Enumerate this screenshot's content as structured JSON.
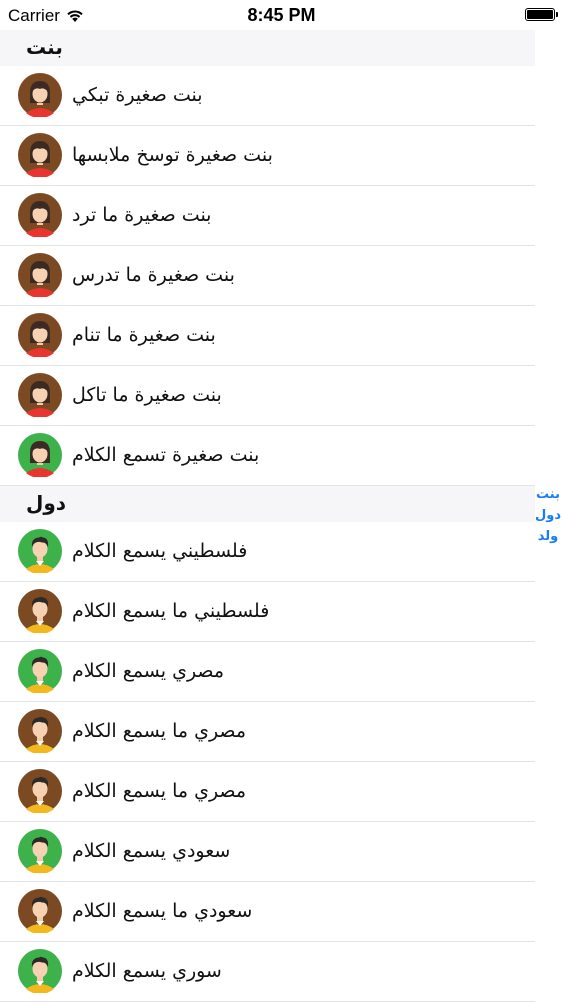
{
  "status_bar": {
    "carrier": "Carrier",
    "time": "8:45 PM",
    "battery_level": 1.0
  },
  "colors": {
    "accent": "#1a7cf5",
    "header_bg": "#f6f6f8",
    "avatar_brown": "#7b4a23",
    "avatar_green": "#3db14a",
    "girl_shirt": "#e8352f",
    "boy_shirt": "#f2b81e"
  },
  "sections": [
    {
      "title": "بنت",
      "items": [
        {
          "label": "بنت صغيرة تبكي",
          "avatar": "girl-avatar",
          "bg": "brown"
        },
        {
          "label": "بنت صغيرة توسخ ملابسها",
          "avatar": "girl-avatar",
          "bg": "brown"
        },
        {
          "label": "بنت صغيرة ما ترد",
          "avatar": "girl-avatar",
          "bg": "brown"
        },
        {
          "label": "بنت صغيرة ما تدرس",
          "avatar": "girl-avatar",
          "bg": "brown"
        },
        {
          "label": "بنت صغيرة ما تنام",
          "avatar": "girl-avatar",
          "bg": "brown"
        },
        {
          "label": "بنت صغيرة ما تاكل",
          "avatar": "girl-avatar",
          "bg": "brown"
        },
        {
          "label": "بنت صغيرة تسمع الكلام",
          "avatar": "girl-avatar",
          "bg": "green"
        }
      ]
    },
    {
      "title": "دول",
      "items": [
        {
          "label": "فلسطيني يسمع الكلام",
          "avatar": "boy-avatar",
          "bg": "green"
        },
        {
          "label": "فلسطيني  ما يسمع الكلام",
          "avatar": "boy-avatar",
          "bg": "brown"
        },
        {
          "label": "مصري يسمع الكلام",
          "avatar": "boy-avatar",
          "bg": "green"
        },
        {
          "label": "مصري  ما يسمع الكلام",
          "avatar": "boy-avatar",
          "bg": "brown"
        },
        {
          "label": "مصري  ما يسمع الكلام",
          "avatar": "boy-avatar",
          "bg": "brown"
        },
        {
          "label": "سعودي يسمع الكلام",
          "avatar": "boy-avatar",
          "bg": "green"
        },
        {
          "label": "سعودي  ما يسمع الكلام",
          "avatar": "boy-avatar",
          "bg": "brown"
        },
        {
          "label": "سوري يسمع الكلام",
          "avatar": "boy-avatar",
          "bg": "green"
        }
      ]
    }
  ],
  "section_index": [
    "بنت",
    "دول",
    "ولد"
  ]
}
